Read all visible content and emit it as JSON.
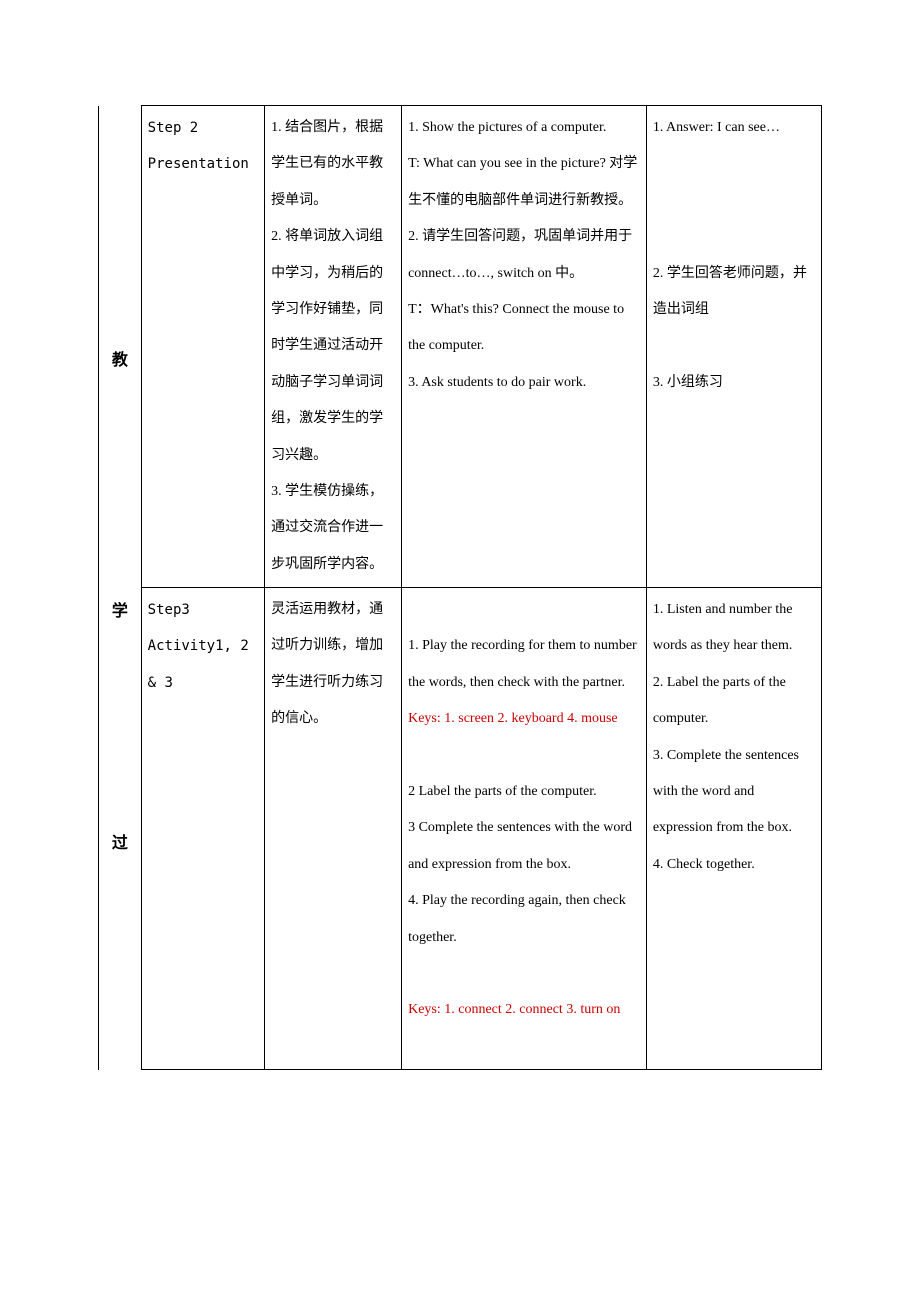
{
  "sideTitle": {
    "c1": "教",
    "c2": "学",
    "c3": "过"
  },
  "rows": [
    {
      "step": "Step 2\nPresentation",
      "intent": "1. 结合图片，根据学生已有的水平教授单词。\n2. 将单词放入词组中学习，为稍后的学习作好铺垫，同时学生通过活动开动脑子学习单词词组，激发学生的学习兴趣。\n3. 学生模仿操练，通过交流合作进一步巩固所学内容。",
      "teacher": "1. Show the pictures of a computer.\nT: What can you see in the picture? 对学生不懂的电脑部件单词进行新教授。\n2. 请学生回答问题，巩固单词并用于 connect…to…, switch on 中。\nT：What's this? Connect the mouse to the computer.\n3. Ask students to do pair work.",
      "student": "1. Answer: I can see…\n\n\n\n2. 学生回答老师问题，并造出词组\n\n3. 小组练习"
    },
    {
      "step": "Step3\nActivity1, 2 & 3",
      "intent": "灵活运用教材，通过听力训练，增加学生进行听力练习的信心。",
      "teacher_plain1": "1. Play the recording for them to number the words, then check with the partner.",
      "teacher_red1": "Keys: 1. screen  2. keyboard 4. mouse",
      "teacher_plain2": "2 Label the parts of the computer.\n3 Complete the sentences with the word and expression from the box.\n4. Play the recording again, then check together.",
      "teacher_red2": "Keys: 1. connect  2. connect 3. turn on",
      "student": "1. Listen and number the words as they hear them.\n2. Label the parts of the computer.\n3. Complete the sentences with the word and expression from the box.\n4. Check together."
    }
  ]
}
